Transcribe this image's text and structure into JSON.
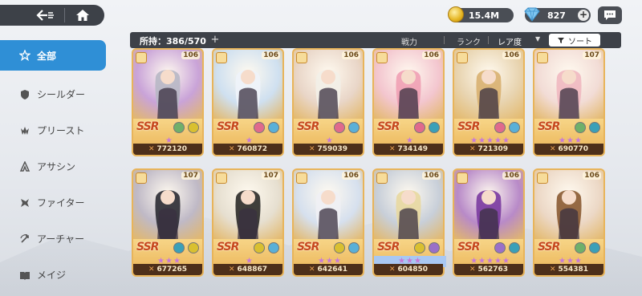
{
  "header": {
    "coins": "15.4M",
    "gems": "827"
  },
  "sidebar": {
    "items": [
      {
        "label": "全部",
        "icon": "star-icon",
        "active": true
      },
      {
        "label": "シールダー",
        "icon": "shield-icon"
      },
      {
        "label": "プリースト",
        "icon": "priest-icon"
      },
      {
        "label": "アサシン",
        "icon": "assassin-icon"
      },
      {
        "label": "ファイター",
        "icon": "fighter-icon"
      },
      {
        "label": "アーチャー",
        "icon": "archer-icon"
      },
      {
        "label": "メイジ",
        "icon": "mage-icon"
      }
    ]
  },
  "filter": {
    "owned_label": "所持：386/570",
    "sort_power": "戦力",
    "sort_rank": "ランク",
    "sort_rarity": "レア度",
    "sort_button": "ソート"
  },
  "cards": [
    {
      "rarity": "SSR",
      "level": "106",
      "power": "772120",
      "stars": "★",
      "art": "#c9a3d8",
      "hair": "#b7b7c4",
      "el1": "#6fb06a",
      "el2": "#d9c030"
    },
    {
      "rarity": "SSR",
      "level": "106",
      "power": "760872",
      "stars": "★",
      "art": "#cfe0f0",
      "hair": "#eef3fa",
      "el1": "#e06a8c",
      "el2": "#5ab0d8"
    },
    {
      "rarity": "SSR",
      "level": "106",
      "power": "759039",
      "stars": "★",
      "art": "#e9d6c8",
      "hair": "#f2efe8",
      "el1": "#e06a8c",
      "el2": "#5ab0d8"
    },
    {
      "rarity": "SSR",
      "level": "106",
      "power": "734149",
      "stars": "★",
      "art": "#f3c6cf",
      "hair": "#f0a0b4",
      "el1": "#e06a8c",
      "el2": "#3aa0b8"
    },
    {
      "rarity": "SSR",
      "level": "106",
      "power": "721309",
      "stars": "★★★★★",
      "art": "#e8d4b0",
      "hair": "#d8b070",
      "el1": "#e06a8c",
      "el2": "#5ab0d8"
    },
    {
      "rarity": "SSR",
      "level": "107",
      "power": "690770",
      "stars": "★★★",
      "art": "#f2dcd6",
      "hair": "#f0b8c0",
      "el1": "#6fb06a",
      "el2": "#3aa0b8"
    },
    {
      "rarity": "SSR",
      "level": "107",
      "power": "677265",
      "stars": "★★★",
      "art": "#bfb9c6",
      "hair": "#2b2b33",
      "el1": "#3aa0b8",
      "el2": "#d9c030"
    },
    {
      "rarity": "SSR",
      "level": "107",
      "power": "648867",
      "stars": "★",
      "art": "#e6dfd0",
      "hair": "#2b2a28",
      "el1": "#d9c030",
      "el2": "#5ab0d8"
    },
    {
      "rarity": "SSR",
      "level": "106",
      "power": "642641",
      "stars": "★★★",
      "art": "#d6e0ee",
      "hair": "#f0f0f4",
      "el1": "#d9c030",
      "el2": "#5ab0d8"
    },
    {
      "rarity": "SSR",
      "level": "106",
      "power": "604850",
      "stars": "★★★",
      "art": "#c8cfd9",
      "hair": "#e8d8a0",
      "el1": "#d9c030",
      "el2": "#9a70c8",
      "blue": true
    },
    {
      "rarity": "SSR",
      "level": "106",
      "power": "562763",
      "stars": "★★★★★",
      "art": "#b88ac8",
      "hair": "#7a3aa0",
      "el1": "#9a70c8",
      "el2": "#3aa0b8"
    },
    {
      "rarity": "SSR",
      "level": "106",
      "power": "554381",
      "stars": "★★★",
      "art": "#ecd8c6",
      "hair": "#8a5a32",
      "el1": "#6fb06a",
      "el2": "#3aa0b8"
    }
  ]
}
